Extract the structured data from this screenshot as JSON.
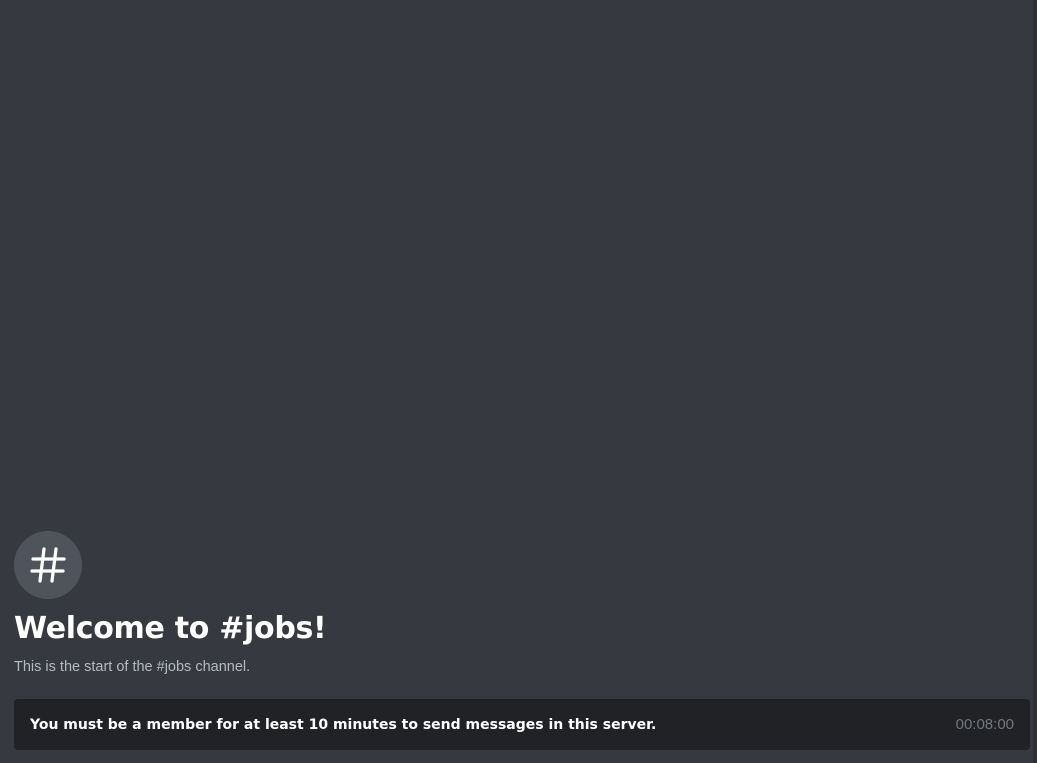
{
  "channel": {
    "icon": "hash-icon",
    "welcome_title": "Welcome to #jobs!",
    "welcome_subtitle": "This is the start of the #jobs channel."
  },
  "notice": {
    "message": "You must be a member for at least 10 minutes to send messages in this server.",
    "timer": "00:08:00"
  },
  "colors": {
    "background": "#36393f",
    "badge": "#4f545c",
    "notice_bar": "#202225",
    "text_primary": "#ffffff",
    "text_muted": "#b5bac1",
    "timer_text": "#72767d"
  }
}
